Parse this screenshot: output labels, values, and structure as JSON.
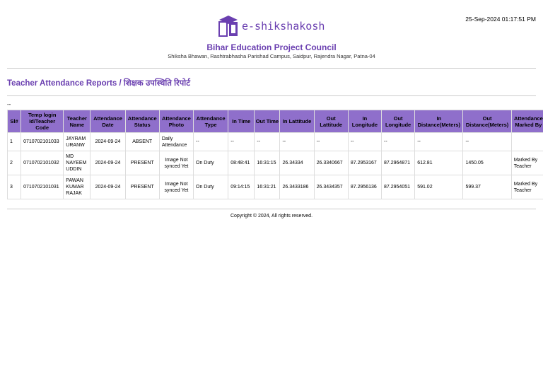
{
  "header": {
    "timestamp": "25-Sep-2024 01:17:51 PM",
    "logo_text": "e-shikshakosh",
    "org": "Bihar Education Project Council",
    "address": "Shiksha Bhawan, Rashtrabhasha Parishad Campus, Saidpur, Rajendra Nagar, Patna-04"
  },
  "report": {
    "title": "Teacher Attendance Reports / शिक्षक उपस्थिति रिपोर्ट",
    "filter": "--"
  },
  "table": {
    "columns": [
      "Sl#",
      "Temp login Id/Teacher Code",
      "Teacher Name",
      "Attendance Date",
      "Attendance Status",
      "Attendance Photo",
      "Attendance Type",
      "In Time",
      "Out Time",
      "In Lattitude",
      "Out Lattitude",
      "In Longitude",
      "Out Longitude",
      "In Distance(Meters)",
      "Out Distance(Meters)",
      "Attendance Marked By"
    ],
    "rows": [
      [
        "1",
        "0710702101033",
        "JAYRAM URANW",
        "2024-09-24",
        "ABSENT",
        "Daily Attendance",
        "--",
        "--",
        "--",
        "--",
        "--",
        "--",
        "--",
        "--",
        "--",
        ""
      ],
      [
        "2",
        "0710702101032",
        "MD NAYEEM UDDIN",
        "2024-09-24",
        "PRESENT",
        "Image Not synced Yet",
        "On Duty",
        "08:48:41",
        "16:31:15",
        "26.34334",
        "26.3340667",
        "87.2953167",
        "87.2964871",
        "612.81",
        "1450.05",
        "Marked By Teacher"
      ],
      [
        "3",
        "0710702101031",
        "PAWAN KUMAR RAJAK",
        "2024-09-24",
        "PRESENT",
        "Image Not synced Yet",
        "On Duty",
        "09:14:15",
        "16:31:21",
        "26.3433186",
        "26.3434357",
        "87.2956136",
        "87.2954051",
        "591.02",
        "599.37",
        "Marked By Teacher"
      ]
    ]
  },
  "footer": {
    "copyright": "Copyright © 2024, All rights reserved."
  }
}
